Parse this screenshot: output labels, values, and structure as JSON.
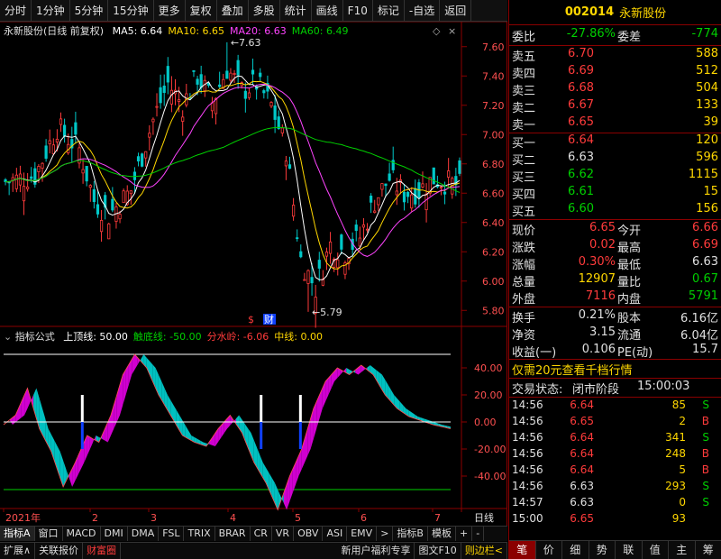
{
  "toolbar": {
    "items": [
      "分时",
      "1分钟",
      "5分钟",
      "15分钟",
      "更多",
      "复权",
      "叠加",
      "多股",
      "统计",
      "画线",
      "F10",
      "标记",
      "-自选",
      "返回"
    ],
    "more_arrow": "›"
  },
  "chart": {
    "title": "永新股份(日线 前复权)",
    "ma": [
      {
        "label": "MA5: 6.64",
        "color": "#ffffff"
      },
      {
        "label": "MA10: 6.65",
        "color": "#ffd700"
      },
      {
        "label": "MA20: 6.63",
        "color": "#ff44ff"
      },
      {
        "label": "MA60: 6.49",
        "color": "#00d000"
      }
    ],
    "high_label": "7.63",
    "low_label": "5.79",
    "price_ticks": [
      "7.60",
      "7.40",
      "7.20",
      "7.00",
      "6.80",
      "6.60",
      "6.40",
      "6.20",
      "6.00",
      "5.80"
    ],
    "markers": [
      "$",
      "财"
    ],
    "indicator": {
      "name": "指标公式",
      "items": [
        {
          "label": "上顶线: 50.00",
          "color": "#ffffff"
        },
        {
          "label": "触底线: -50.00",
          "color": "#00d000"
        },
        {
          "label": "分水岭: -6.06",
          "color": "#ff3b3b"
        },
        {
          "label": "中线: 0.00",
          "color": "#ffd700"
        }
      ],
      "ticks": [
        "40.00",
        "20.00",
        "0.00",
        "-20.00",
        "-40.00"
      ]
    },
    "x_labels": [
      "2021年",
      "2",
      "3",
      "4",
      "5",
      "6",
      "7"
    ],
    "x_unit": "日线"
  },
  "tabs": [
    "指标A",
    "窗口",
    "MACD",
    "DMI",
    "DMA",
    "FSL",
    "TRIX",
    "BRAR",
    "CR",
    "VR",
    "OBV",
    "ASI",
    "EMV",
    ">",
    "指标B",
    "模板",
    "+",
    "-"
  ],
  "status": {
    "left": [
      "扩展∧",
      "关联报价",
      "财富圈"
    ],
    "right": [
      "新用户福利专享",
      "图文F10",
      "则边栏<"
    ]
  },
  "quote": {
    "code": "002014",
    "name": "永新股份",
    "weibi_label": "委比",
    "weibi": "-27.86%",
    "weicha_label": "委差",
    "weicha": "-774",
    "asks": [
      {
        "label": "卖五",
        "price": "6.70",
        "vol": "588"
      },
      {
        "label": "卖四",
        "price": "6.69",
        "vol": "512"
      },
      {
        "label": "卖三",
        "price": "6.68",
        "vol": "504"
      },
      {
        "label": "卖二",
        "price": "6.67",
        "vol": "133"
      },
      {
        "label": "卖一",
        "price": "6.65",
        "vol": "39"
      }
    ],
    "bids": [
      {
        "label": "买一",
        "price": "6.64",
        "vol": "120"
      },
      {
        "label": "买二",
        "price": "6.63",
        "vol": "596"
      },
      {
        "label": "买三",
        "price": "6.62",
        "vol": "1115"
      },
      {
        "label": "买四",
        "price": "6.61",
        "vol": "15"
      },
      {
        "label": "买五",
        "price": "6.60",
        "vol": "156"
      }
    ],
    "stats": [
      {
        "l1": "现价",
        "v1": "6.65",
        "l2": "今开",
        "v2": "6.66"
      },
      {
        "l1": "涨跌",
        "v1": "0.02",
        "l2": "最高",
        "v2": "6.69"
      },
      {
        "l1": "涨幅",
        "v1": "0.30%",
        "l2": "最低",
        "v2": "6.63"
      },
      {
        "l1": "总量",
        "v1": "12907",
        "l2": "量比",
        "v2": "0.67"
      },
      {
        "l1": "外盘",
        "v1": "7116",
        "l2": "内盘",
        "v2": "5791"
      }
    ],
    "stats2": [
      {
        "l1": "换手",
        "v1": "0.21%",
        "l2": "股本",
        "v2": "6.16亿"
      },
      {
        "l1": "净资",
        "v1": "3.15",
        "l2": "流通",
        "v2": "6.04亿"
      },
      {
        "l1": "收益(一)",
        "v1": "0.106",
        "l2": "PE(动)",
        "v2": "15.7"
      }
    ],
    "promo": "仅需20元查看千档行情",
    "trade_state_label": "交易状态:",
    "trade_state": "闭市阶段",
    "trade_time": "15:00:03",
    "ticks": [
      {
        "time": "14:56",
        "price": "6.64",
        "vol": "85",
        "side": "S"
      },
      {
        "time": "14:56",
        "price": "6.65",
        "vol": "2",
        "side": "B"
      },
      {
        "time": "14:56",
        "price": "6.64",
        "vol": "341",
        "side": "S"
      },
      {
        "time": "14:56",
        "price": "6.64",
        "vol": "248",
        "side": "B"
      },
      {
        "time": "14:56",
        "price": "6.64",
        "vol": "5",
        "side": "B"
      },
      {
        "time": "14:56",
        "price": "6.63",
        "vol": "293",
        "side": "S"
      },
      {
        "time": "14:57",
        "price": "6.63",
        "vol": "0",
        "side": "S"
      },
      {
        "time": "15:00",
        "price": "6.65",
        "vol": "93",
        "side": ""
      }
    ],
    "nav": [
      "笔",
      "价",
      "细",
      "势",
      "联",
      "值",
      "主",
      "筹"
    ]
  }
}
